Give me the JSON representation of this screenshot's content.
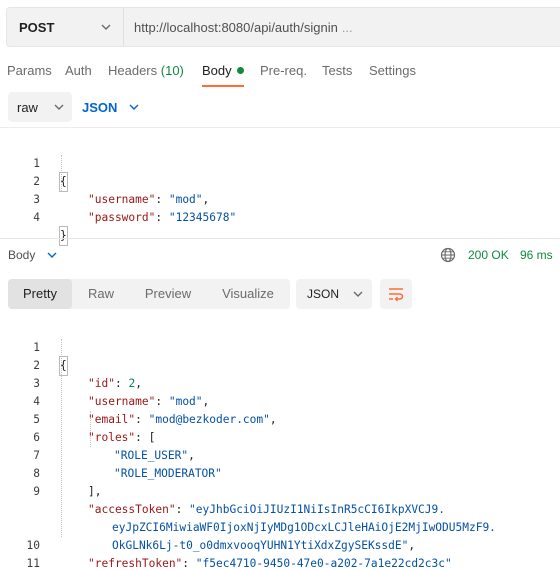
{
  "request": {
    "method": "POST",
    "url": "http://localhost:8080/api/auth/signin",
    "url_ellipsis": "..."
  },
  "tabs": [
    {
      "label": "Params"
    },
    {
      "label": "Auth"
    },
    {
      "label": "Headers",
      "count": "(10)"
    },
    {
      "label": "Body",
      "active": true
    },
    {
      "label": "Pre-req."
    },
    {
      "label": "Tests"
    },
    {
      "label": "Settings"
    }
  ],
  "body_type": {
    "mode": "raw",
    "language": "JSON"
  },
  "request_body_lines": [
    {
      "num": "1",
      "text": "{"
    },
    {
      "num": "2",
      "key": "\"username\"",
      "value": "\"mod\"",
      "comma": ","
    },
    {
      "num": "3",
      "key": "\"password\"",
      "value": "\"12345678\"",
      "comma": ""
    },
    {
      "num": "4",
      "text": "}"
    }
  ],
  "response": {
    "section_label": "Body",
    "status": "200 OK",
    "time": "96 ms",
    "view_tabs": [
      "Pretty",
      "Raw",
      "Preview",
      "Visualize"
    ],
    "active_view": "Pretty",
    "format": "JSON"
  },
  "response_body_lines": [
    {
      "num": "1",
      "text": "{"
    },
    {
      "num": "2",
      "text": "\"id\": 2,"
    },
    {
      "num": "3",
      "text": "\"username\": \"mod\","
    },
    {
      "num": "4",
      "text": "\"email\": \"mod@bezkoder.com\","
    },
    {
      "num": "5",
      "text": "\"roles\": ["
    },
    {
      "num": "6",
      "text": "\"ROLE_USER\","
    },
    {
      "num": "7",
      "text": "\"ROLE_MODERATOR\""
    },
    {
      "num": "8",
      "text": "],"
    },
    {
      "num": "9",
      "text": "\"accessToken\": \"eyJhbGciOiJIUzI1NiIsInR5cCI6IkpXVCJ9."
    },
    {
      "num": "",
      "text": "eyJpZCI6MiwiaWF0IjoxNjIyMDg1ODcxLCJleHAiOjE2MjIwODU5MzF9."
    },
    {
      "num": "",
      "text": "OkGLNk6Lj-t0_o0dmxvooqYUHN1YtiXdxZgySEKssdE\","
    },
    {
      "num": "10",
      "text": "\"refreshToken\": \"f5ec4710-9450-47e0-a202-7a1e22cd2c3c\""
    },
    {
      "num": "11",
      "text": "}"
    }
  ],
  "colors": {
    "accent": "#ff6c37",
    "success": "#0f8a3d",
    "json_key": "#9a1515",
    "json_string": "#0451a5",
    "json_number": "#098658",
    "link_blue": "#0265d2"
  },
  "icons": {
    "method_dropdown": "chevron-down-icon",
    "globe": "globe-icon",
    "wrap": "wrap-lines-icon"
  }
}
